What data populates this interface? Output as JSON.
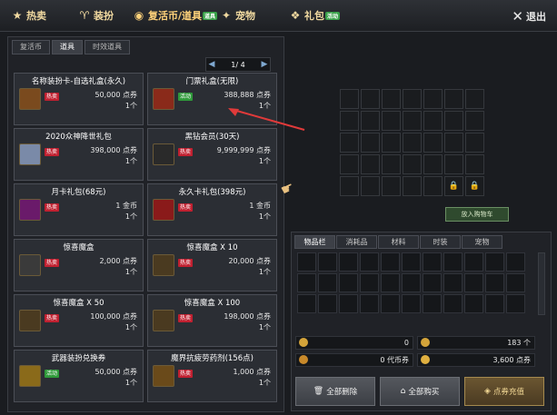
{
  "topnav": [
    {
      "label": "热卖",
      "icon": "★",
      "sub": ""
    },
    {
      "label": "装扮",
      "icon": "♈",
      "sub": ""
    },
    {
      "label": "复活币/道具",
      "icon": "◉",
      "sub": "道具"
    },
    {
      "label": "宠物",
      "icon": "✦",
      "sub": ""
    },
    {
      "label": "礼包",
      "icon": "❖",
      "sub": "活动"
    }
  ],
  "exit_label": "退出",
  "left_tabs": [
    "复活币",
    "道具",
    "时效道具"
  ],
  "pager": {
    "text": "1/ 4"
  },
  "tag_labels": {
    "hot": "热卖",
    "evt": "活动"
  },
  "items": [
    {
      "name": "名称装扮卡-自选礼盒(永久)",
      "tag": "hot",
      "price": "50,000 点券",
      "qty": "1个",
      "thumb": "#7a4a1e"
    },
    {
      "name": "门票礼盒(无限)",
      "tag": "evt",
      "price": "388,888 点券",
      "qty": "1个",
      "thumb": "#8a2a1a"
    },
    {
      "name": "2020众神降世礼包",
      "tag": "hot",
      "price": "398,000 点券",
      "qty": "1个",
      "thumb": "#7a8aa8"
    },
    {
      "name": "黑钻会员(30天)",
      "tag": "hot",
      "price": "9,999,999 点券",
      "qty": "1个",
      "thumb": "#2a2a2a"
    },
    {
      "name": "月卡礼包(68元)",
      "tag": "hot",
      "price": "1 金币",
      "qty": "1个",
      "thumb": "#6a1a6a"
    },
    {
      "name": "永久卡礼包(398元)",
      "tag": "hot",
      "price": "1 金币",
      "qty": "1个",
      "thumb": "#8a1a1a"
    },
    {
      "name": "惊喜魔盒",
      "tag": "hot",
      "price": "2,000 点券",
      "qty": "1个",
      "thumb": "#3a3a3a"
    },
    {
      "name": "惊喜魔盒 X 10",
      "tag": "hot",
      "price": "20,000 点券",
      "qty": "1个",
      "thumb": "#4a3a20"
    },
    {
      "name": "惊喜魔盒 X 50",
      "tag": "hot",
      "price": "100,000 点券",
      "qty": "1个",
      "thumb": "#4a3a20"
    },
    {
      "name": "惊喜魔盒 X 100",
      "tag": "hot",
      "price": "198,000 点券",
      "qty": "1个",
      "thumb": "#4a3a20"
    },
    {
      "name": "武器装扮兑换券",
      "tag": "evt",
      "price": "50,000 点券",
      "qty": "1个",
      "thumb": "#8a6a1a"
    },
    {
      "name": "魔界抗疲劳药剂(156点)",
      "tag": "hot",
      "price": "1,000 点券",
      "qty": "1个",
      "thumb": "#6a4a1a"
    }
  ],
  "cart_button": "放入购物车",
  "inv_tabs": [
    "物品栏",
    "消耗品",
    "材料",
    "时装",
    "宠物"
  ],
  "balances": {
    "a": "0",
    "b": "183 个",
    "c": "0 代币券",
    "d": "3,600 点券"
  },
  "actions": {
    "remove_all": "全部删除",
    "buy_all": "全部购买",
    "checkout": "点券充值"
  }
}
